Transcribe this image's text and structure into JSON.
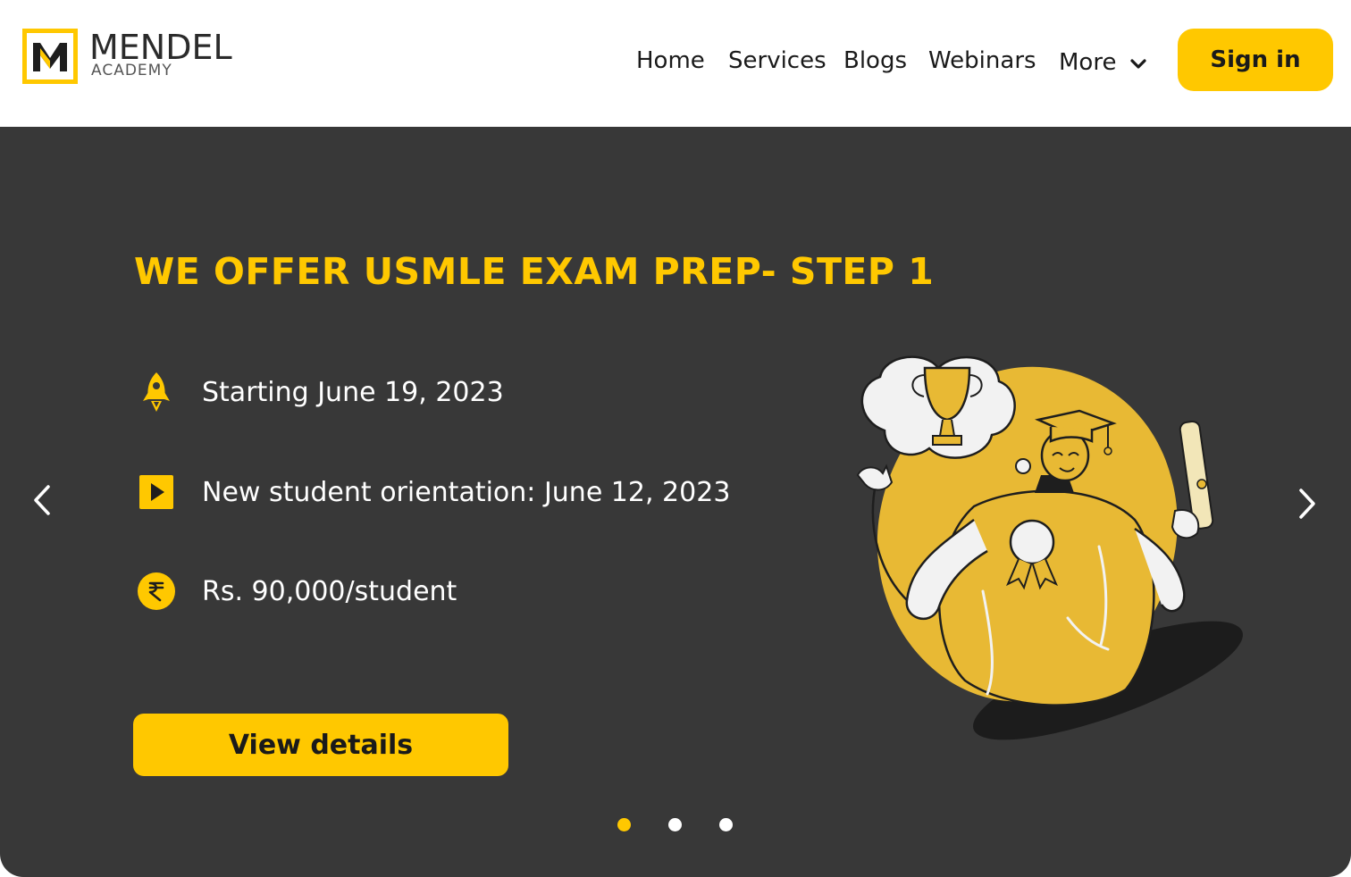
{
  "brand": {
    "logo_letter": "M",
    "name": "MENDEL",
    "sub": "ACADEMY",
    "accent": "#ffc800",
    "dark": "#383838"
  },
  "nav": {
    "items": [
      "Home",
      "Services",
      "Blogs",
      "Webinars"
    ],
    "more_label": "More",
    "signin_label": "Sign in"
  },
  "hero": {
    "title": "WE OFFER USMLE EXAM PREP- STEP 1",
    "features": [
      {
        "icon": "rocket-icon",
        "text": "Starting June 19, 2023"
      },
      {
        "icon": "play-icon",
        "text": "New student orientation: June 12, 2023"
      },
      {
        "icon": "rupee-icon",
        "text": "Rs. 90,000/student"
      }
    ],
    "cta_label": "View details",
    "carousel": {
      "total_slides": 3,
      "active_slide": 1
    }
  }
}
